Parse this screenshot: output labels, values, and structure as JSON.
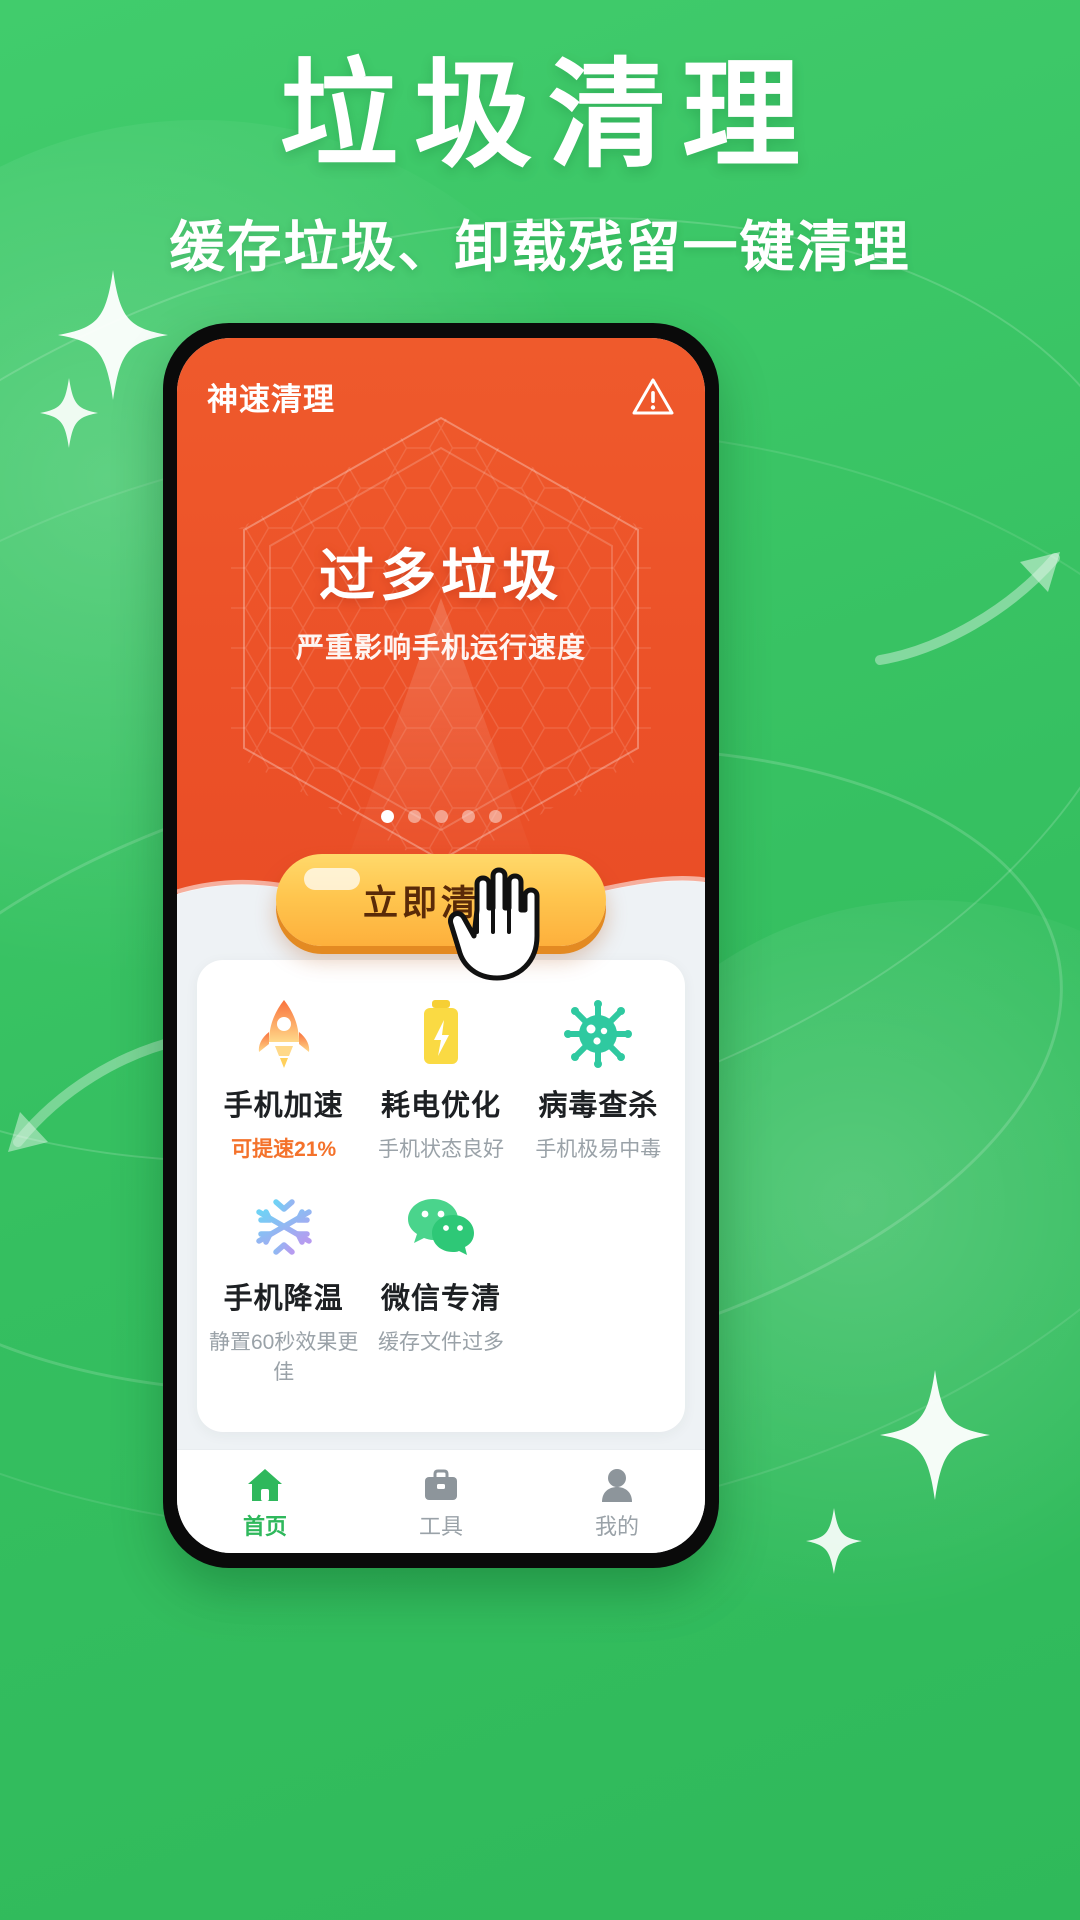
{
  "promo": {
    "title": "垃圾清理",
    "subtitle": "缓存垃圾、卸载残留一键清理",
    "bg_color": "#3fc96a"
  },
  "phone": {
    "app_bar": {
      "title": "神速清理",
      "warning_icon": "warning-triangle-icon"
    },
    "hero": {
      "headline": "过多垃圾",
      "subline": "严重影响手机运行速度",
      "bg_color": "#ec5128",
      "carousel": {
        "total": 5,
        "active_index": 0
      }
    },
    "cta": {
      "label": "立即清理",
      "color_start": "#ffd96b",
      "color_end": "#fdb03c",
      "text_color": "#5a2a08",
      "cursor_icon": "hand-pointer-icon"
    },
    "features": [
      {
        "icon": "rocket-icon",
        "name": "手机加速",
        "desc": "可提速21%",
        "desc_style": "warn"
      },
      {
        "icon": "battery-icon",
        "name": "耗电优化",
        "desc": "手机状态良好",
        "desc_style": "muted"
      },
      {
        "icon": "virus-icon",
        "name": "病毒查杀",
        "desc": "手机极易中毒",
        "desc_style": "muted"
      },
      {
        "icon": "snowflake-icon",
        "name": "手机降温",
        "desc": "静置60秒效果更佳",
        "desc_style": "muted"
      },
      {
        "icon": "wechat-icon",
        "name": "微信专清",
        "desc": "缓存文件过多",
        "desc_style": "muted"
      }
    ],
    "tabbar": [
      {
        "icon": "home-icon",
        "label": "首页",
        "active": true
      },
      {
        "icon": "toolbox-icon",
        "label": "工具",
        "active": false
      },
      {
        "icon": "person-icon",
        "label": "我的",
        "active": false
      }
    ],
    "accent_color": "#2fb85c"
  }
}
